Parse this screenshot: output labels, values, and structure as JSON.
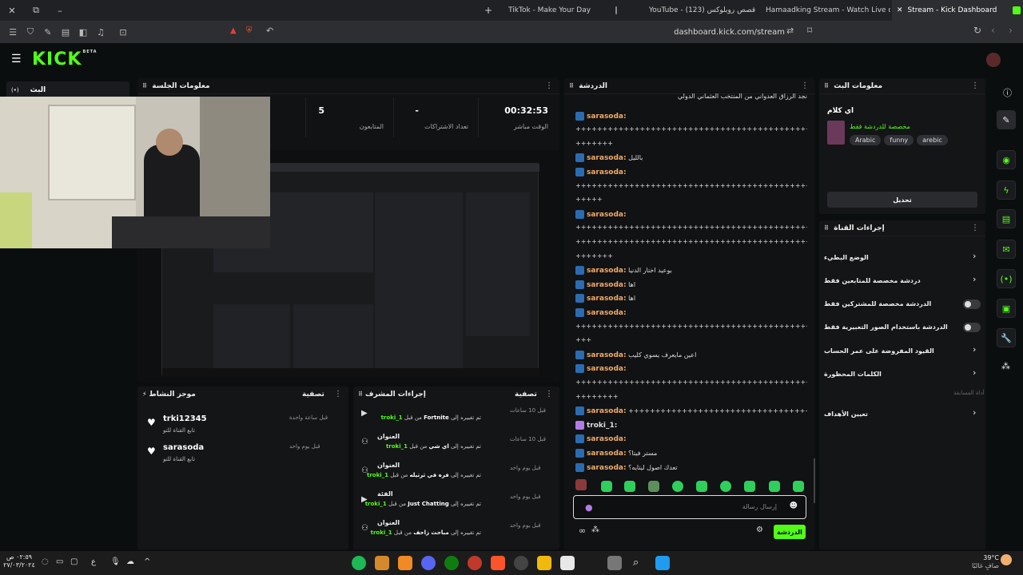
{
  "browser": {
    "tabs": [
      {
        "label": "TikTok - Make Your Day"
      },
      {
        "label": "YouTube - (123) قصص روبلوكس"
      },
      {
        "label": "Hamaadking Stream - Watch Live on"
      },
      {
        "label": "Stream - Kick Dashboard"
      }
    ],
    "new_tab": "+",
    "url": "dashboard.kick.com/stream"
  },
  "kick": {
    "logo": "KICK",
    "logo_badge": "BETA",
    "stream_label": "البث",
    "stream_badge": "(•)"
  },
  "session": {
    "title": "معلومات الجلسة",
    "stats": [
      {
        "value": "00:32:53",
        "label": "الوقت مباشر"
      },
      {
        "value": "-",
        "label": "تعداد الاشتراكات"
      },
      {
        "value": "5",
        "label": "المتابعون"
      }
    ]
  },
  "chat": {
    "title": "الدردشة",
    "lines": [
      {
        "user": "",
        "text": "نجد الرزاق العدواني من المنتخب العثماني الدولي"
      },
      {
        "user": "sarasoda:",
        "text": ""
      },
      {
        "user": "",
        "text": "++++++++++++++++++++++++++++++++++++++++++++++++++++++"
      },
      {
        "user": "",
        "text": "+++++++"
      },
      {
        "user": "sarasoda:",
        "text": "بالليل"
      },
      {
        "user": "sarasoda:",
        "text": ""
      },
      {
        "user": "",
        "text": "++++++++++++++++++++++++++++++++++++++++++++++++++++++"
      },
      {
        "user": "",
        "text": "+++++"
      },
      {
        "user": "sarasoda:",
        "text": ""
      },
      {
        "user": "",
        "text": "++++++++++++++++++++++++++++++++++++++++++++++++++++++"
      },
      {
        "user": "",
        "text": "++++++++++++++++++++++++++++++++++++++++++++++++++++++"
      },
      {
        "user": "",
        "text": "+++++++"
      },
      {
        "user": "sarasoda:",
        "text": "بوعيد اختار الدنيا"
      },
      {
        "user": "sarasoda:",
        "text": "اها"
      },
      {
        "user": "sarasoda:",
        "text": "اها"
      },
      {
        "user": "sarasoda:",
        "text": ""
      },
      {
        "user": "",
        "text": "++++++++++++++++++++++++++++++++++++++++++++++++++++++"
      },
      {
        "user": "",
        "text": "+++"
      },
      {
        "user": "sarasoda:",
        "text": "اعين مايعرف يسوي كليب"
      },
      {
        "user": "sarasoda:",
        "text": ""
      },
      {
        "user": "",
        "text": "++++++++++++++++++++++++++++++++++++++++++++++++++++++"
      },
      {
        "user": "",
        "text": "++++++++"
      },
      {
        "user": "sarasoda:",
        "text": "+++++++++++++++++++++++++++++++++++++++++++++"
      },
      {
        "user": "troki_1:",
        "text": ""
      },
      {
        "user": "sarasoda:",
        "text": ""
      },
      {
        "user": "sarasoda:",
        "text": "مستر فيتا؟"
      },
      {
        "user": "sarasoda:",
        "text": "تعدك اصول ليتايه؟"
      }
    ],
    "input_placeholder": "إرسال رسالة",
    "send_label": "الدردشة"
  },
  "stream_info": {
    "title": "معلومات البث",
    "stream_title": "اي كلام",
    "category": "مخصصة للدردشة فقط",
    "tags": [
      "Arabic",
      "funny",
      "arebic"
    ],
    "edit_label": "تحديل"
  },
  "channel_actions": {
    "title": "إجراءات القناة",
    "items": [
      {
        "label": "الوضع البطيء",
        "control": "chevron"
      },
      {
        "label": "دردشة مخصصة للمتابعين فقط",
        "control": "chevron"
      },
      {
        "label": "الدردشة مخصصة للمشتركين فقط",
        "control": "toggle"
      },
      {
        "label": "الدردشة باستخدام الصور التعبيرية فقط",
        "control": "toggle"
      },
      {
        "label": "القيود المفروضة على عمر الحساب",
        "control": "chevron"
      },
      {
        "label": "الكلمات المحظورة",
        "control": "chevron"
      }
    ],
    "special_section": "أداة المسابقة",
    "goals": "تعيين الأهداف"
  },
  "activity": {
    "title": "موجز النشاط",
    "filter": "تصفية",
    "items": [
      {
        "user": "trki12345",
        "desc": "تابع القناة للتو",
        "time": "قبل ساعة واحدة"
      },
      {
        "user": "sarasoda",
        "desc": "تابع القناة للتو",
        "time": "قبل يوم واحد"
      }
    ]
  },
  "mod_actions": {
    "title": "إجراءات المشرف",
    "filter": "تصفية",
    "items": [
      {
        "title": "",
        "desc_pre": "troki_1",
        "desc_mid": " من قبل ",
        "desc_val": "Fortnite",
        "desc_post": " تم تغييره إلى ",
        "time": "قبل 10 ساعات"
      },
      {
        "title": "العنوان",
        "desc_pre": "troki_1",
        "desc_mid": " من قبل ",
        "desc_val": "اي شي",
        "desc_post": " تم تغييره إلى ",
        "time": "قبل 10 ساعات"
      },
      {
        "title": "العنوان",
        "desc_pre": "troki_1",
        "desc_mid": " من قبل ",
        "desc_val": "فره في ثرتيله",
        "desc_post": " تم تغييره إلى ",
        "time": "قبل يوم واحد"
      },
      {
        "title": "الفئة",
        "desc_pre": "troki_1",
        "desc_mid": " من قبل ",
        "desc_val": "Just Chatting",
        "desc_post": " تم تغييره إلى ",
        "time": "قبل يوم واحد"
      },
      {
        "title": "العنوان",
        "desc_pre": "troki_1",
        "desc_mid": " من قبل ",
        "desc_val": "مباحث زاحف",
        "desc_post": " تم تغييره إلى ",
        "time": "قبل يوم واحد"
      }
    ]
  },
  "taskbar": {
    "time": "٠٢:٥٩ ص",
    "date": "٢٧/٠٣/٢٠٢٤",
    "lang": "ع",
    "weather_temp": "39°C",
    "weather_desc": "صافٍ غالبًا"
  },
  "colors": {
    "kick_green": "#53fc18",
    "username": "#f0ab68",
    "panel": "#141517"
  }
}
